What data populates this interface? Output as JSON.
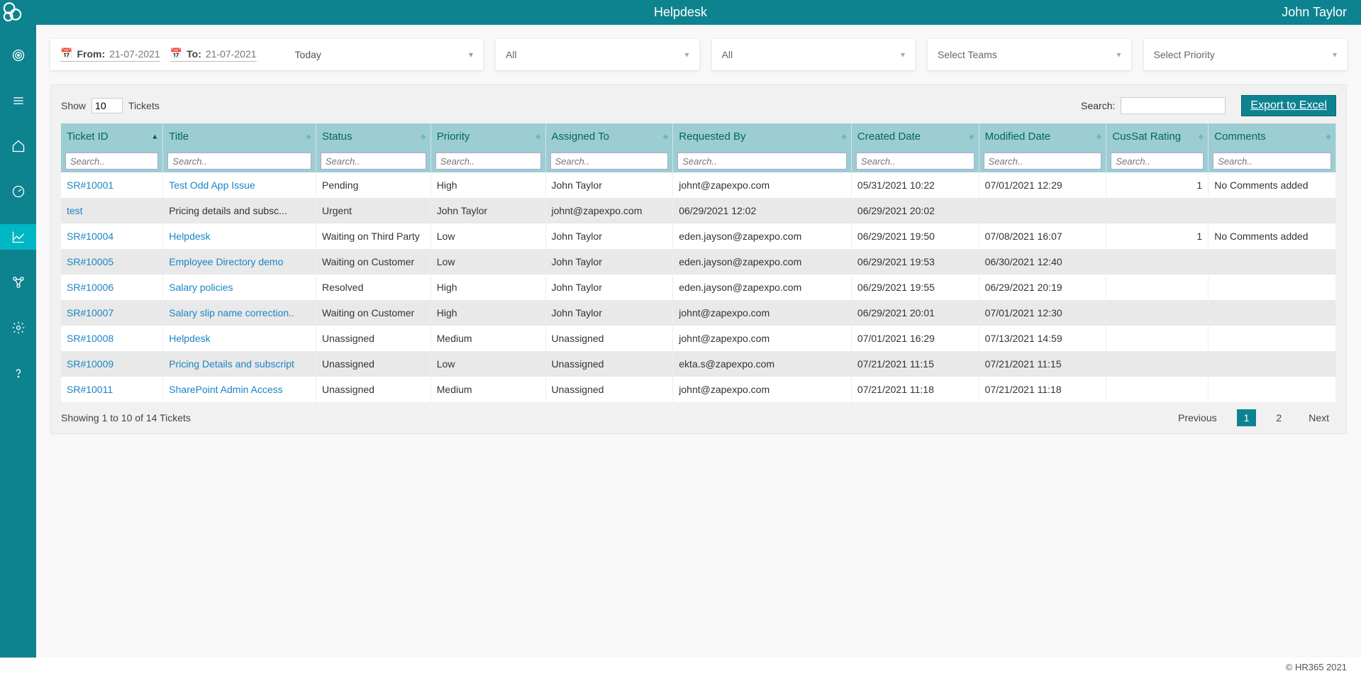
{
  "header": {
    "title": "Helpdesk",
    "user": "John Taylor"
  },
  "filters": {
    "from_label": "From:",
    "from_value": "21-07-2021",
    "to_label": "To:",
    "to_value": "21-07-2021",
    "preset": "Today",
    "ddl1": "All",
    "ddl2": "All",
    "ddl3": "Select Teams",
    "ddl4": "Select Priority"
  },
  "table_top": {
    "show_label": "Show",
    "show_value": "10",
    "show_suffix": "Tickets",
    "search_label": "Search:",
    "export_label": "Export to Excel"
  },
  "columns": [
    "Ticket ID",
    "Title",
    "Status",
    "Priority",
    "Assigned To",
    "Requested By",
    "Created Date",
    "Modified Date",
    "CusSat Rating",
    "Comments"
  ],
  "search_placeholder": "Search..",
  "rows": [
    {
      "id": "SR#10001",
      "title": "Test Odd App Issue",
      "status": "Pending",
      "priority": "High",
      "assigned": "John Taylor",
      "requested": "johnt@zapexpo.com",
      "created": "05/31/2021 10:22",
      "modified": "07/01/2021 12:29",
      "rating": "1",
      "comments": "No Comments added",
      "id_link": true,
      "title_link": true
    },
    {
      "id": "test",
      "title": "Pricing details and subsc...",
      "status": "Urgent",
      "priority": "John Taylor",
      "assigned": "johnt@zapexpo.com",
      "requested": "06/29/2021 12:02",
      "created": "06/29/2021 20:02",
      "modified": "",
      "rating": "",
      "comments": "",
      "id_link": true,
      "title_link": false
    },
    {
      "id": "SR#10004",
      "title": "Helpdesk",
      "status": "Waiting on Third Party",
      "priority": "Low",
      "assigned": "John Taylor",
      "requested": "eden.jayson@zapexpo.com",
      "created": "06/29/2021 19:50",
      "modified": "07/08/2021 16:07",
      "rating": "1",
      "comments": "No Comments added",
      "id_link": true,
      "title_link": true
    },
    {
      "id": "SR#10005",
      "title": "Employee Directory demo",
      "status": "Waiting on Customer",
      "priority": "Low",
      "assigned": "John Taylor",
      "requested": "eden.jayson@zapexpo.com",
      "created": "06/29/2021 19:53",
      "modified": "06/30/2021 12:40",
      "rating": "",
      "comments": "",
      "id_link": true,
      "title_link": true
    },
    {
      "id": "SR#10006",
      "title": "Salary policies",
      "status": "Resolved",
      "priority": "High",
      "assigned": "John Taylor",
      "requested": "eden.jayson@zapexpo.com",
      "created": "06/29/2021 19:55",
      "modified": "06/29/2021 20:19",
      "rating": "",
      "comments": "",
      "id_link": true,
      "title_link": true
    },
    {
      "id": "SR#10007",
      "title": "Salary slip name correction..",
      "status": "Waiting on Customer",
      "priority": "High",
      "assigned": "John Taylor",
      "requested": "johnt@zapexpo.com",
      "created": "06/29/2021 20:01",
      "modified": "07/01/2021 12:30",
      "rating": "",
      "comments": "",
      "id_link": true,
      "title_link": true
    },
    {
      "id": "SR#10008",
      "title": "Helpdesk",
      "status": "Unassigned",
      "priority": "Medium",
      "assigned": "Unassigned",
      "requested": "johnt@zapexpo.com",
      "created": "07/01/2021 16:29",
      "modified": "07/13/2021 14:59",
      "rating": "",
      "comments": "",
      "id_link": true,
      "title_link": true
    },
    {
      "id": "SR#10009",
      "title": "Pricing Details and subscript",
      "status": "Unassigned",
      "priority": "Low",
      "assigned": "Unassigned",
      "requested": "ekta.s@zapexpo.com",
      "created": "07/21/2021 11:15",
      "modified": "07/21/2021 11:15",
      "rating": "",
      "comments": "",
      "id_link": true,
      "title_link": true
    },
    {
      "id": "SR#10011",
      "title": "SharePoint Admin Access",
      "status": "Unassigned",
      "priority": "Medium",
      "assigned": "Unassigned",
      "requested": "johnt@zapexpo.com",
      "created": "07/21/2021 11:18",
      "modified": "07/21/2021 11:18",
      "rating": "",
      "comments": "",
      "id_link": true,
      "title_link": true
    }
  ],
  "footer": {
    "info": "Showing 1 to 10 of 14 Tickets",
    "prev": "Previous",
    "next": "Next",
    "pages": [
      "1",
      "2"
    ],
    "active_page": 0
  },
  "copyright": "© HR365 2021"
}
